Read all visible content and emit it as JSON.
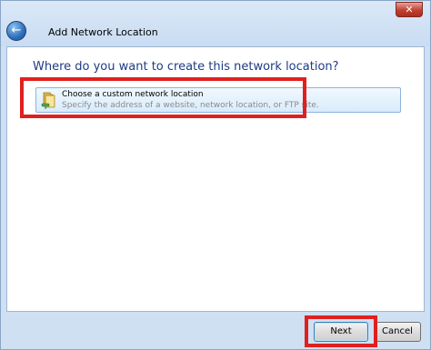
{
  "window": {
    "title": "Add Network Location",
    "close_glyph": "✕",
    "back_glyph": "←"
  },
  "main": {
    "question": "Where do you want to create this network location?",
    "options": [
      {
        "title": "Choose a custom network location",
        "description": "Specify the address of a website, network location, or FTP site.",
        "icon": "folder-network-icon"
      }
    ]
  },
  "buttons": {
    "next": "Next",
    "cancel": "Cancel"
  },
  "colors": {
    "heading": "#1d3b84",
    "highlight": "#e0201e",
    "option_border": "#8cb4dd"
  }
}
